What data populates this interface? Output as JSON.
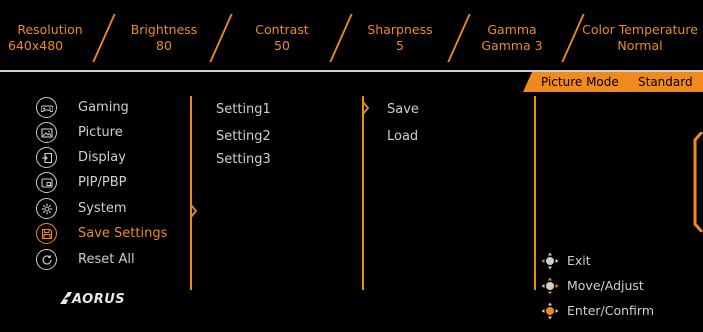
{
  "status_bar": {
    "items": [
      {
        "label": "Resolution",
        "value": "640x480"
      },
      {
        "label": "Brightness",
        "value": "80"
      },
      {
        "label": "Contrast",
        "value": "50"
      },
      {
        "label": "Sharpness",
        "value": "5"
      },
      {
        "label": "Gamma",
        "value": "Gamma 3"
      },
      {
        "label": "Color Temperature",
        "value": "Normal"
      }
    ]
  },
  "picture_mode": {
    "label": "Picture Mode",
    "value": "Standard"
  },
  "main_menu": {
    "items": [
      {
        "label": "Gaming",
        "icon": "gamepad-icon"
      },
      {
        "label": "Picture",
        "icon": "picture-icon"
      },
      {
        "label": "Display",
        "icon": "display-input-icon"
      },
      {
        "label": "PIP/PBP",
        "icon": "pip-icon"
      },
      {
        "label": "System",
        "icon": "gear-icon"
      },
      {
        "label": "Save Settings",
        "icon": "save-icon",
        "active": true
      },
      {
        "label": "Reset All",
        "icon": "reset-icon"
      }
    ]
  },
  "submenu": {
    "items": [
      "Setting1",
      "Setting2",
      "Setting3"
    ]
  },
  "actions": {
    "items": [
      "Save",
      "Load"
    ]
  },
  "hints": {
    "exit": "Exit",
    "move": "Move/Adjust",
    "confirm": "Enter/Confirm"
  },
  "logo_text": "AORUS",
  "colors": {
    "accent": "#f08a1c",
    "text": "#cfcfcf",
    "background": "#000000"
  }
}
